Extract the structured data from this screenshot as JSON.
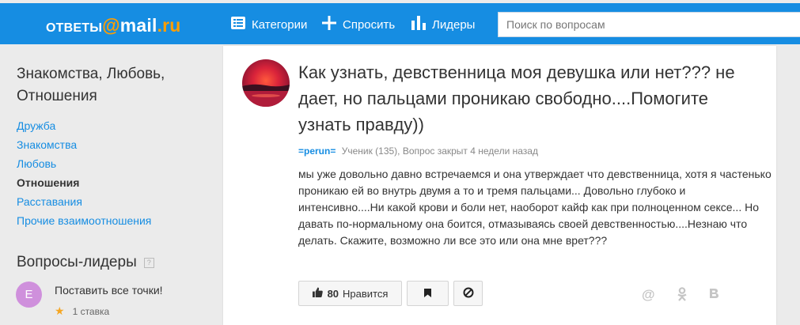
{
  "header": {
    "logo": {
      "left": "ОТВЕТЫ",
      "at": "@",
      "mail": "mail",
      "dot": ".",
      "ru": "ru"
    },
    "nav": [
      {
        "label": "Категории",
        "icon": "list-icon"
      },
      {
        "label": "Спросить",
        "icon": "plus-icon"
      },
      {
        "label": "Лидеры",
        "icon": "bar-chart-icon"
      }
    ],
    "search": {
      "placeholder": "Поиск по вопросам",
      "value": ""
    }
  },
  "sidebar": {
    "category_title": "Знакомства, Любовь, Отношения",
    "subcategories": [
      {
        "label": "Дружба",
        "active": false
      },
      {
        "label": "Знакомства",
        "active": false
      },
      {
        "label": "Любовь",
        "active": false
      },
      {
        "label": "Отношения",
        "active": true
      },
      {
        "label": "Расставания",
        "active": false
      },
      {
        "label": "Прочие взаимоотношения",
        "active": false
      }
    ],
    "leaders": {
      "title": "Вопросы-лидеры",
      "help": "?",
      "item": {
        "avatar_letter": "Е",
        "question": "Поставить все точки!",
        "stakes": "1 ставка"
      }
    }
  },
  "question": {
    "title": "Как узнать, девственница моя девушка или нет??? не дает, но пальцами проникаю свободно....Помогите узнать правду))",
    "author": "=perun=",
    "meta": "Ученик (135), Вопрос закрыт 4 недели назад",
    "body": "мы уже довольно давно встречаемся и она утверждает что девственница, хотя я частенько проникаю ей во внутрь двумя а то и тремя пальцами... Довольно глубоко и интенсивно....Ни какой крови и боли нет, наоборот кайф как при полноценном сексе... Но давать по-нормальному она боится, отмазываясь своей девственностью....Незнаю что делать. Скажите, возможно ли все это или она мне врет???",
    "likes": "80",
    "like_label": "Нравится",
    "share": {
      "odnoklassniki": "ок",
      "vk": "в"
    }
  },
  "colors": {
    "header": "#168de2",
    "link": "#168de2",
    "logo_accent": "#ff9e00",
    "avatar": "#cf90dc"
  }
}
